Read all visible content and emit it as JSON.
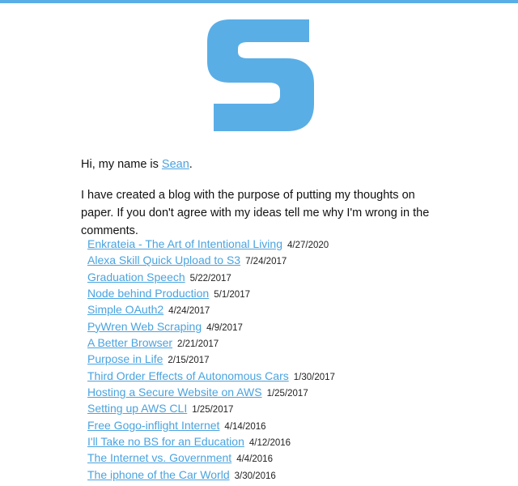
{
  "colors": {
    "accent": "#5aaee6",
    "link": "#4aa3df",
    "text": "#111111"
  },
  "logo": {
    "letter": "S",
    "icon": "s-logo-icon"
  },
  "intro": {
    "greeting_prefix": "Hi, my name is ",
    "name_link": "Sean",
    "greeting_suffix": ".",
    "description": "I have created a blog with the purpose of putting my thoughts on paper. If you don't agree with my ideas tell me why I'm wrong in the comments."
  },
  "posts": [
    {
      "title": "Enkrateia - The Art of Intentional Living",
      "date": "4/27/2020"
    },
    {
      "title": "Alexa Skill Quick Upload to S3",
      "date": "7/24/2017"
    },
    {
      "title": "Graduation Speech",
      "date": "5/22/2017"
    },
    {
      "title": "Node behind Production",
      "date": "5/1/2017"
    },
    {
      "title": "Simple OAuth2",
      "date": "4/24/2017"
    },
    {
      "title": "PyWren Web Scraping",
      "date": "4/9/2017"
    },
    {
      "title": "A Better Browser",
      "date": "2/21/2017"
    },
    {
      "title": "Purpose in Life",
      "date": "2/15/2017"
    },
    {
      "title": "Third Order Effects of Autonomous Cars",
      "date": "1/30/2017"
    },
    {
      "title": "Hosting a Secure Website on AWS",
      "date": "1/25/2017"
    },
    {
      "title": "Setting up AWS CLI",
      "date": "1/25/2017"
    },
    {
      "title": "Free Gogo-inflight Internet",
      "date": "4/14/2016"
    },
    {
      "title": "I'll Take no BS for an Education",
      "date": "4/12/2016"
    },
    {
      "title": "The Internet vs. Government",
      "date": "4/4/2016"
    },
    {
      "title": "The iphone of the Car World",
      "date": "3/30/2016"
    }
  ]
}
